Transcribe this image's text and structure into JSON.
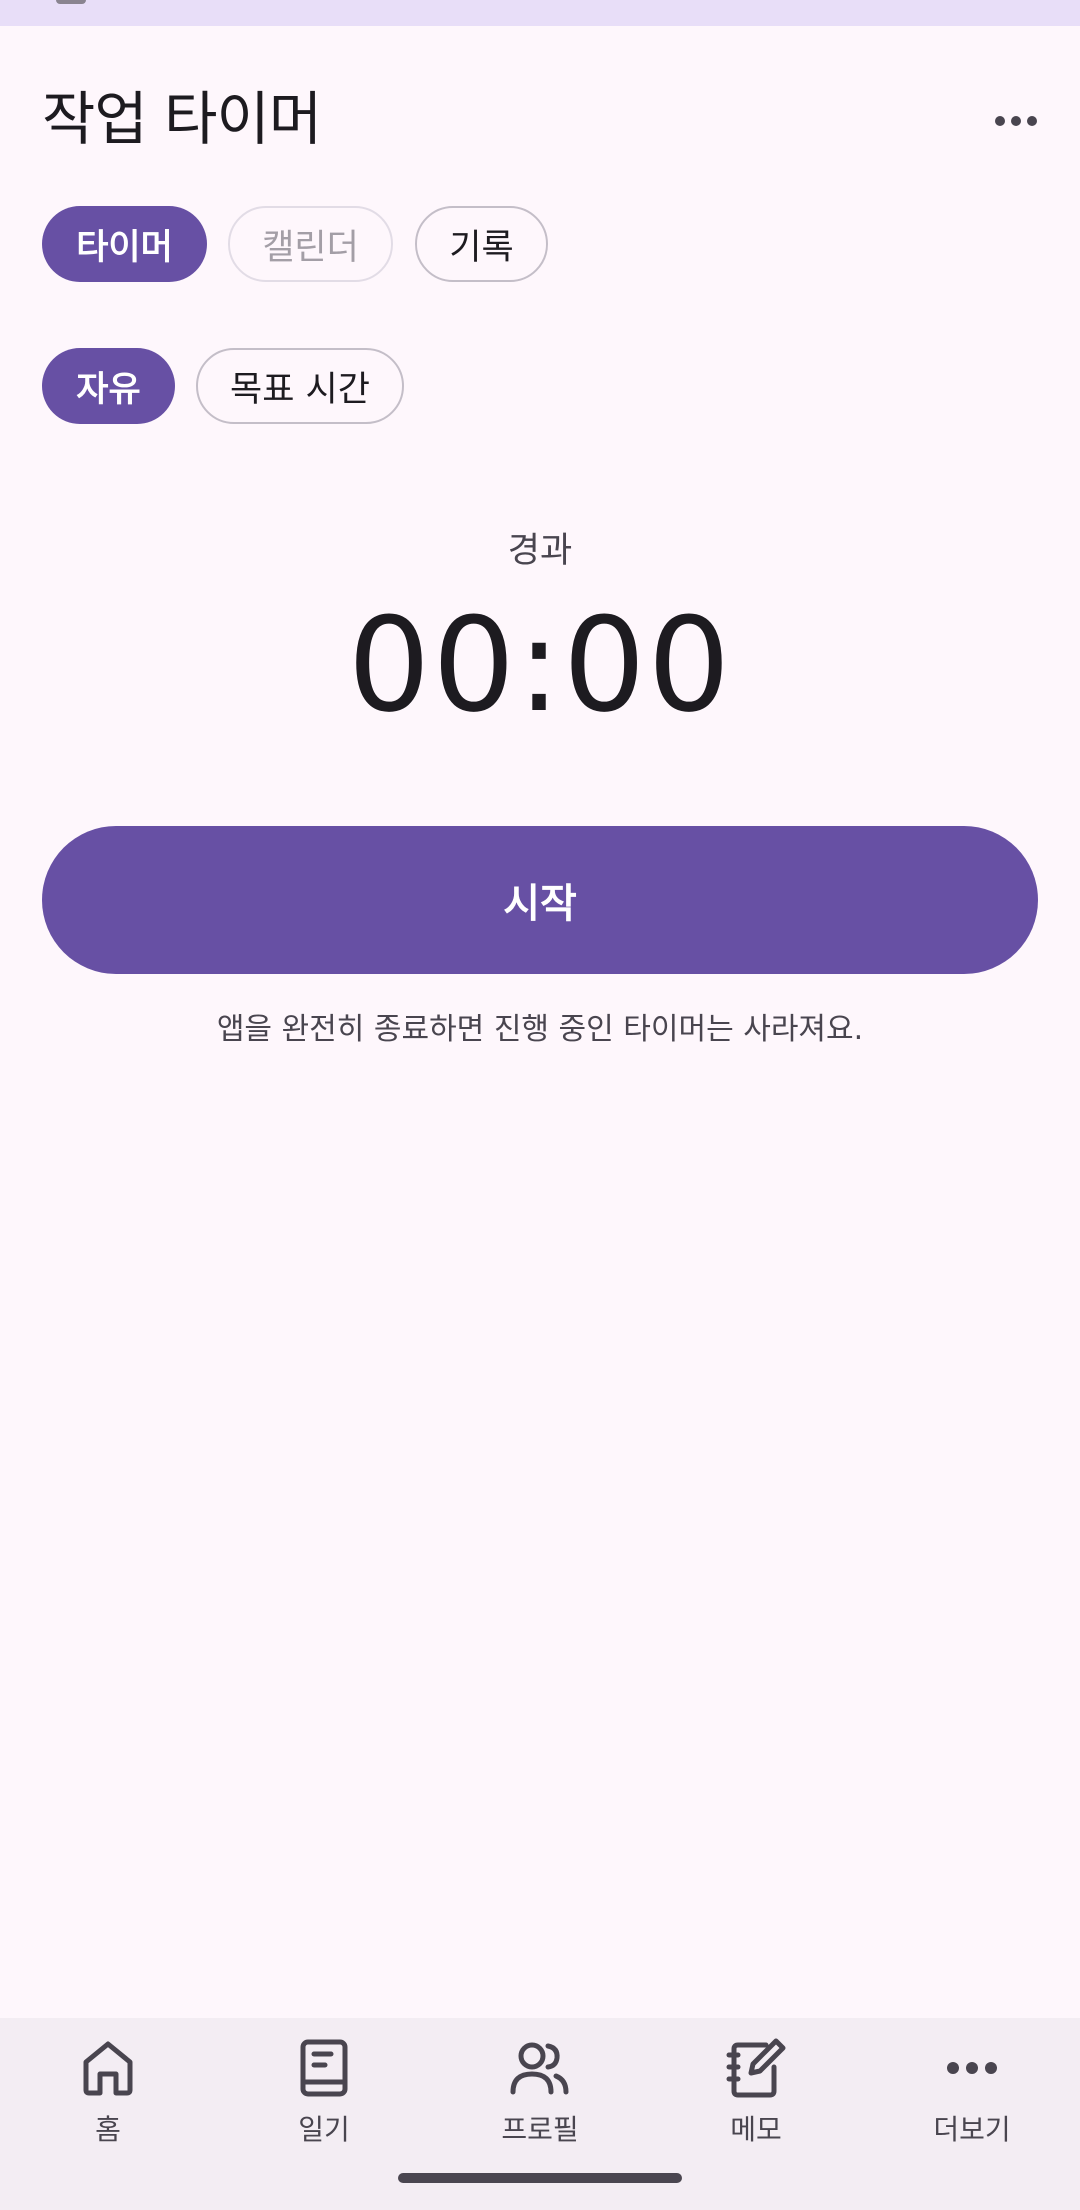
{
  "header": {
    "title": "작업 타이머",
    "overflow_icon": "more-horizontal-icon"
  },
  "tabs": [
    {
      "label": "타이머",
      "state": "selected"
    },
    {
      "label": "캘린더",
      "state": "disabled"
    },
    {
      "label": "기록",
      "state": "default"
    }
  ],
  "modes": [
    {
      "label": "자유",
      "state": "selected"
    },
    {
      "label": "목표 시간",
      "state": "default"
    }
  ],
  "timer": {
    "label": "경과",
    "value": "00:00"
  },
  "start_button": {
    "label": "시작"
  },
  "notice": "앱을 완전히 종료하면 진행 중인 타이머는 사라져요.",
  "bottom_nav": [
    {
      "label": "홈",
      "icon": "home-icon"
    },
    {
      "label": "일기",
      "icon": "book-icon"
    },
    {
      "label": "프로필",
      "icon": "people-icon"
    },
    {
      "label": "메모",
      "icon": "notebook-edit-icon"
    },
    {
      "label": "더보기",
      "icon": "more-horizontal-icon"
    }
  ],
  "colors": {
    "accent": "#6750a4",
    "background": "#fef7fc",
    "status_bar": "#e8def8",
    "nav_background": "#f3edf3"
  }
}
